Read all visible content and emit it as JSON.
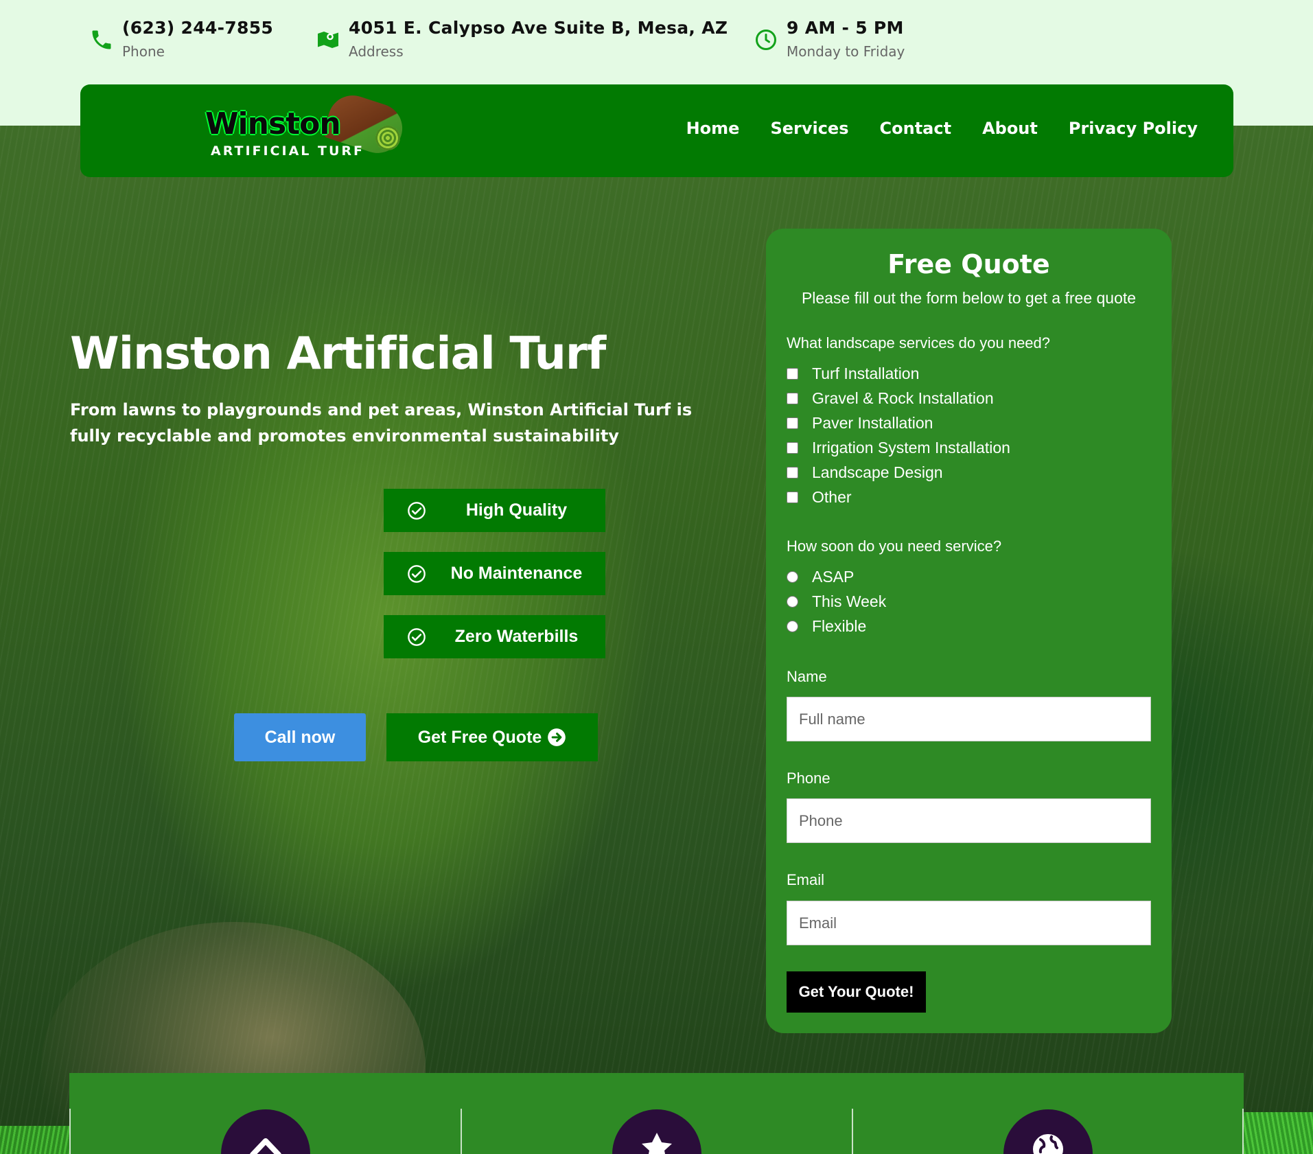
{
  "topbar": {
    "phone": {
      "value": "(623) 244-7855",
      "label": "Phone"
    },
    "address": {
      "value": "4051 E. Calypso Ave Suite B, Mesa, AZ",
      "label": "Address"
    },
    "hours": {
      "value": "9 AM - 5 PM",
      "label": "Monday to Friday"
    }
  },
  "brand": {
    "word": "Winston",
    "tag": "ARTIFICIAL TURF",
    "accent": "#027a02"
  },
  "nav": {
    "items": [
      "Home",
      "Services",
      "Contact",
      "About",
      "Privacy Policy"
    ]
  },
  "hero": {
    "title": "Winston Artificial Turf",
    "lead": "From lawns to playgrounds and pet areas, Winston Artificial Turf is fully recyclable and promotes environmental sustainability",
    "badges": [
      "High Quality",
      "No Maintenance",
      "Zero Waterbills"
    ],
    "call_button": "Call now",
    "quote_button": "Get Free Quote"
  },
  "quote": {
    "title": "Free Quote",
    "description": "Please fill out the form below to get a free quote",
    "services_question": "What landscape services do you need?",
    "services": [
      "Turf Installation",
      "Gravel & Rock Installation",
      "Paver Installation",
      "Irrigation System Installation",
      "Landscape Design",
      "Other"
    ],
    "timing_question": "How soon do you need service?",
    "timing": [
      "ASAP",
      "This Week",
      "Flexible"
    ],
    "name_label": "Name",
    "name_placeholder": "Full name",
    "phone_label": "Phone",
    "phone_placeholder": "Phone",
    "email_label": "Email",
    "email_placeholder": "Email",
    "submit": "Get Your Quote!"
  },
  "features": {
    "icons": [
      "chevron-up-icon",
      "star-icon",
      "globe-icon"
    ]
  }
}
